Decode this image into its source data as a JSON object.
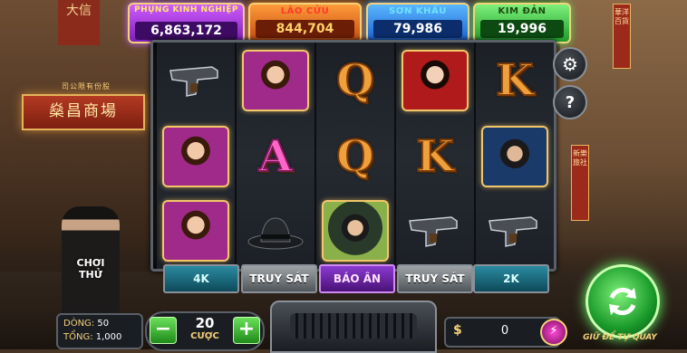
{
  "background": {
    "shop_sign": "燊昌商場",
    "shop_sub_sign": "司公限有份股",
    "top_sign": "大信",
    "right_vsign_1": "華洋百貨",
    "right_vsign_2": "新樂旅社"
  },
  "jackpots": [
    {
      "label": "PHỤNG KINH NGHIỆP",
      "value": "6,863,172",
      "color": "#9b3ad6"
    },
    {
      "label": "LÃO CỬU",
      "value": "844,704",
      "color": "#e06a1e"
    },
    {
      "label": "SƠN KHẨU",
      "value": "79,986",
      "color": "#2a7ae0"
    },
    {
      "label": "KIM ĐẢN",
      "value": "19,996",
      "color": "#34b83a"
    }
  ],
  "reels": [
    [
      "pistol-icon",
      "portrait-woman-purple",
      "empty"
    ],
    [
      "portrait-woman-purple",
      "letter-A",
      "fedora-hat-icon"
    ],
    [
      "letter-Q",
      "letter-Q",
      "portrait-gangster-green"
    ],
    [
      "portrait-woman-red",
      "letter-K",
      "pistol-icon"
    ],
    [
      "letter-K",
      "portrait-gangster-blue",
      "pistol-icon"
    ]
  ],
  "symbol_letters": {
    "A": "A",
    "Q": "Q",
    "K": "K"
  },
  "reel_tags": [
    "4K",
    "TRUY SÁT",
    "BÁO ÂN",
    "TRUY SÁT",
    "2K"
  ],
  "side_buttons": {
    "settings": "gear-icon",
    "help_label": "?"
  },
  "demo_label": "CHƠI THỬ",
  "lines": {
    "label": "DÒNG:",
    "value": "50"
  },
  "total": {
    "label": "TỔNG:",
    "value": "1,000"
  },
  "bet": {
    "minus": "−",
    "plus": "+",
    "value": "20",
    "caption": "CƯỢC"
  },
  "balance": {
    "currency": "$",
    "amount": "0",
    "plus_icon": "⚡"
  },
  "spin": {
    "caption": "GIỮ ĐỂ TỰ QUAY"
  },
  "colors": {
    "accent_gold": "#f5d27a",
    "spin_green": "#3acd3a"
  }
}
